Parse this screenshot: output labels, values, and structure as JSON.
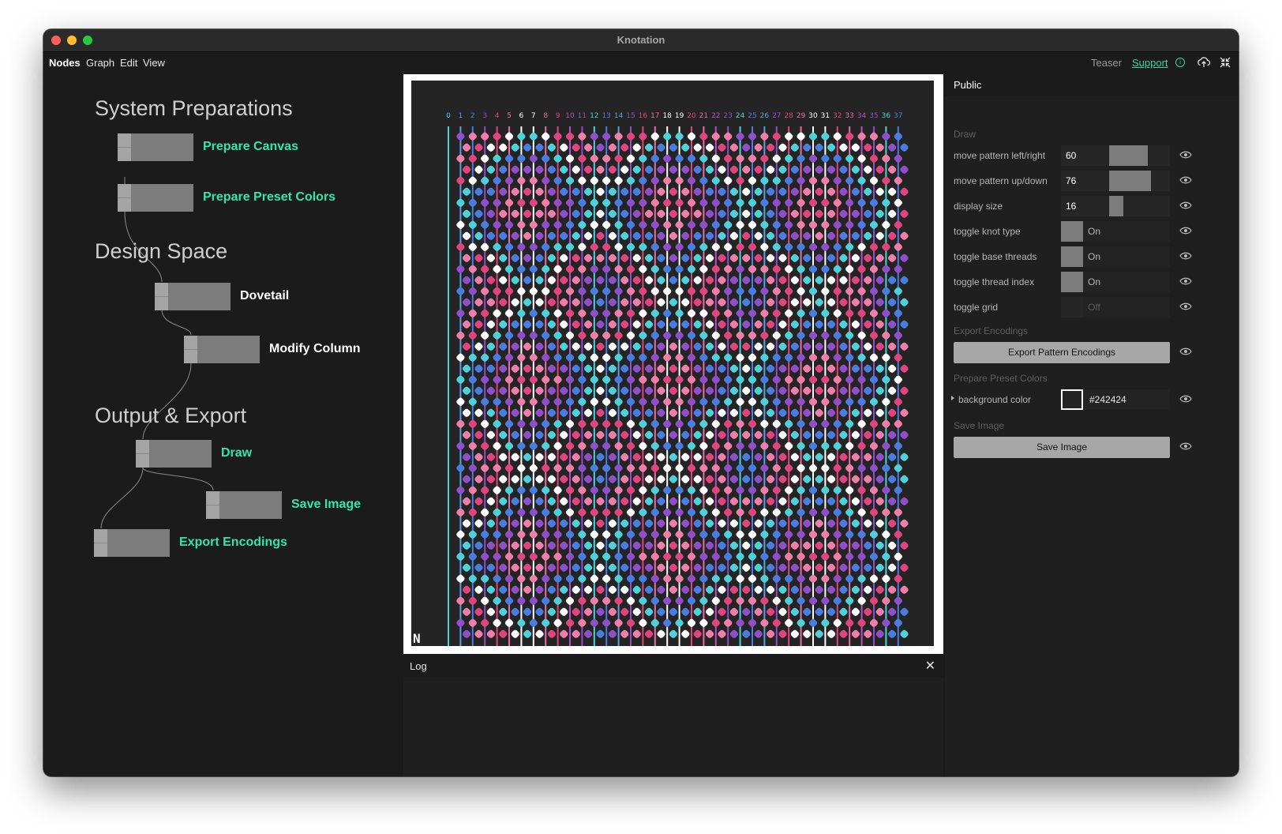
{
  "window": {
    "title": "Knotation"
  },
  "menu": {
    "items": [
      "Nodes",
      "Graph",
      "Edit",
      "View"
    ],
    "right": {
      "teaser": "Teaser",
      "support": "Support"
    }
  },
  "sections": [
    "System Preparations",
    "Design Space",
    "Output & Export"
  ],
  "nodes": [
    {
      "label": "Prepare Canvas",
      "style": "green"
    },
    {
      "label": "Prepare Preset Colors",
      "style": "green"
    },
    {
      "label": "Dovetail",
      "style": "white"
    },
    {
      "label": "Modify Column",
      "style": "white"
    },
    {
      "label": "Draw",
      "style": "green"
    },
    {
      "label": "Save Image",
      "style": "green"
    },
    {
      "label": "Export Encodings",
      "style": "green"
    }
  ],
  "canvas": {
    "thread_indices": [
      "0",
      "1",
      "2",
      "3",
      "4",
      "5",
      "6",
      "7",
      "8",
      "9",
      "10",
      "11",
      "12",
      "13",
      "14",
      "15",
      "16",
      "17",
      "18",
      "19",
      "20",
      "21",
      "22",
      "23",
      "24",
      "25",
      "26",
      "27",
      "28",
      "29",
      "30",
      "31",
      "32",
      "33",
      "34",
      "35",
      "36",
      "37"
    ],
    "thread_colors": [
      "#4fd1d9",
      "#5aa0e6",
      "#4a7de0",
      "#8e4fc9",
      "#e0457d",
      "#e76fa4",
      "#ffffff",
      "#ffffff",
      "#e76fa4",
      "#e0457d",
      "#b84fc9",
      "#8e4fc9",
      "#4fd1d9",
      "#4a7de0",
      "#5aa0e6",
      "#8e4fc9",
      "#e0457d",
      "#e76fa4",
      "#ffffff",
      "#ffffff",
      "#e0457d",
      "#e76fa4",
      "#b84fc9",
      "#8e4fc9",
      "#4fd1d9",
      "#4a7de0",
      "#5aa0e6",
      "#8e4fc9",
      "#e0457d",
      "#e76fa4",
      "#ffffff",
      "#ffffff",
      "#e0457d",
      "#e76fa4",
      "#b84fc9",
      "#8e4fc9",
      "#4fd1d9",
      "#4a7de0"
    ],
    "logo": "N"
  },
  "log": {
    "title": "Log"
  },
  "panel": {
    "title": "Public",
    "draw_section": "Draw",
    "params": [
      {
        "label": "move pattern left/right",
        "value": "60",
        "level": 0.64
      },
      {
        "label": "move pattern up/down",
        "value": "76",
        "level": 0.69
      },
      {
        "label": "display size",
        "value": "16",
        "level": 0.23
      }
    ],
    "toggles": [
      {
        "label": "toggle knot type",
        "state": "On",
        "on": true
      },
      {
        "label": "toggle base threads",
        "state": "On",
        "on": true
      },
      {
        "label": "toggle thread index",
        "state": "On",
        "on": true
      },
      {
        "label": "toggle grid",
        "state": "Off",
        "on": false
      }
    ],
    "export_section": "Export Encodings",
    "export_button": "Export Pattern Encodings",
    "preset_section": "Prepare Preset Colors",
    "background_label": "background color",
    "background_value": "#242424",
    "save_section": "Save Image",
    "save_button": "Save Image"
  },
  "colors": {
    "accent": "#31e8a8",
    "canvas_bg": "#242424",
    "knot_pink": "#e0457d",
    "knot_light_pink": "#ef7fa9",
    "knot_purple": "#8e4fc9",
    "knot_blue": "#4a7de0",
    "knot_cyan": "#4fd1d9",
    "border": "#ffffff"
  }
}
